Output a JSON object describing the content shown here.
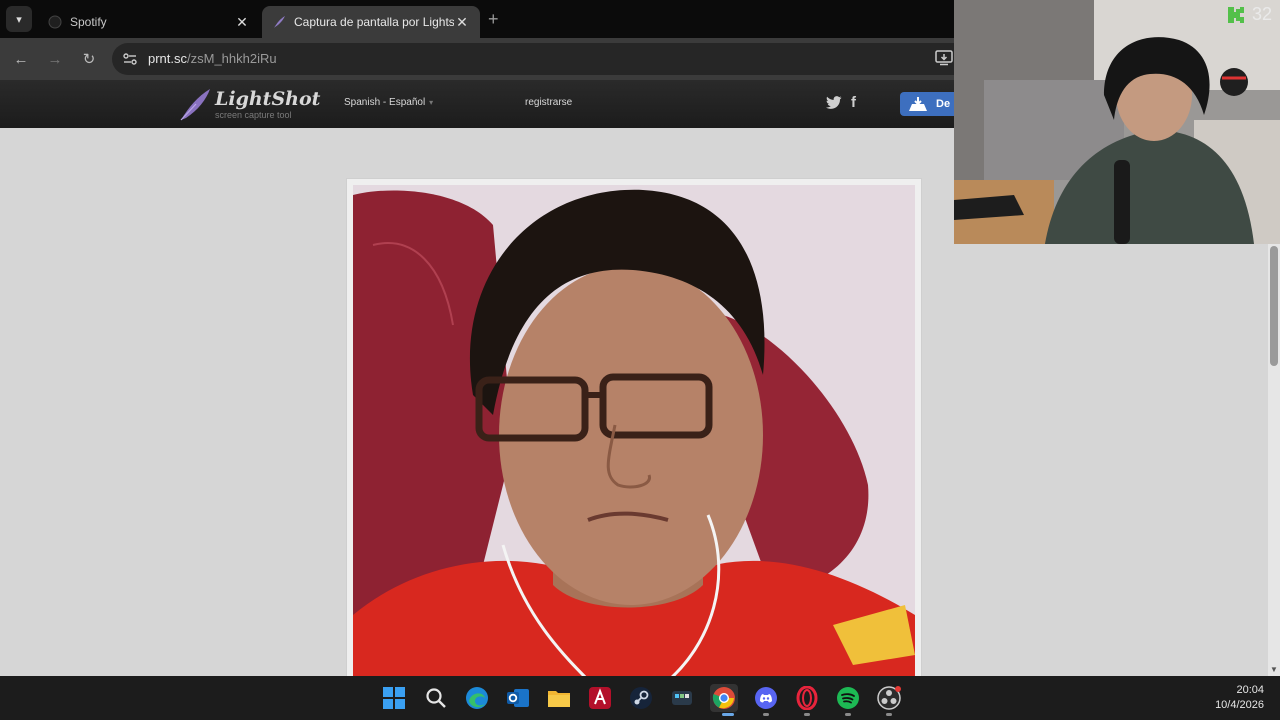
{
  "browser": {
    "tabs": [
      {
        "title": "Spotify",
        "active": false
      },
      {
        "title": "Captura de pantalla por Lightsh",
        "active": true
      }
    ],
    "new_tab": "+",
    "close_glyph": "✕",
    "url_host": "prnt.sc",
    "url_path": "/zsM_hhkh2iRu"
  },
  "lightshot": {
    "logo_text": "LightShot",
    "logo_sub": "screen capture tool",
    "language": "Spanish - Español",
    "register": "registrarse",
    "download_label": "De",
    "accent": "#3d6fbf"
  },
  "stream_overlay": {
    "viewer_count": "32",
    "viewer_icon_color": "#53c04a"
  },
  "taskbar": {
    "apps": [
      "windows-start",
      "search",
      "edge",
      "outlook",
      "file-explorer",
      "adobe",
      "steam",
      "stream-deck",
      "chrome",
      "discord",
      "opera-gx",
      "spotify",
      "obs"
    ],
    "time": "20:04",
    "date": "10/4/2026"
  }
}
